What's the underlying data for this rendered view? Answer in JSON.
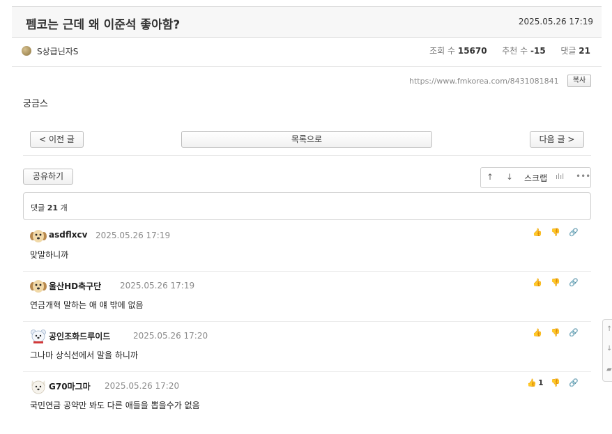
{
  "post": {
    "title": "펨코는 근데 왜 이준석 좋아함?",
    "date": "2025.05.26 17:19",
    "author": "S상급닌자S",
    "views_label": "조회 수",
    "views": "15670",
    "recommend_label": "추천 수",
    "recommend": "-15",
    "comments_label": "댓글",
    "comments": "21",
    "url": "https://www.fmkorea.com/8431081841",
    "copy_label": "복사",
    "body": "궁금스"
  },
  "nav": {
    "prev": "< 이전 글",
    "list": "목록으로",
    "next": "다음 글 >"
  },
  "toolbar": {
    "share": "공유하기",
    "up_icon": "↑",
    "down_icon": "↓",
    "scrap": "스크랩",
    "stats_icon": "ılıl",
    "more_icon": "•••"
  },
  "comment_count": {
    "prefix": "댓글",
    "count": "21",
    "suffix": "개"
  },
  "comments": [
    {
      "name": "asdflxcv",
      "time": "2025.05.26 17:19",
      "text": "맞말하니까",
      "votes": "",
      "avatar": "puppy-icon"
    },
    {
      "name": "울산HD축구단",
      "time": "2025.05.26 17:19",
      "text": "연금개혁 말하는 애 얘 밖에 없음",
      "votes": "",
      "avatar": "puppy-icon"
    },
    {
      "name": "공인조화드루이드",
      "time": "2025.05.26 17:20",
      "text": "그나마 상식선에서 말을 하니까",
      "votes": "",
      "avatar": "polar-bear-icon"
    },
    {
      "name": "G70마그마",
      "time": "2025.05.26 17:20",
      "text": "국민연금 공약만 봐도 다른 애들을 뽑을수가 없음",
      "votes": "1",
      "avatar": "white-dog-icon"
    }
  ],
  "colors": {
    "accent_gray": "#f7f7f7",
    "text": "#222222",
    "meta": "#8a8a8a"
  }
}
